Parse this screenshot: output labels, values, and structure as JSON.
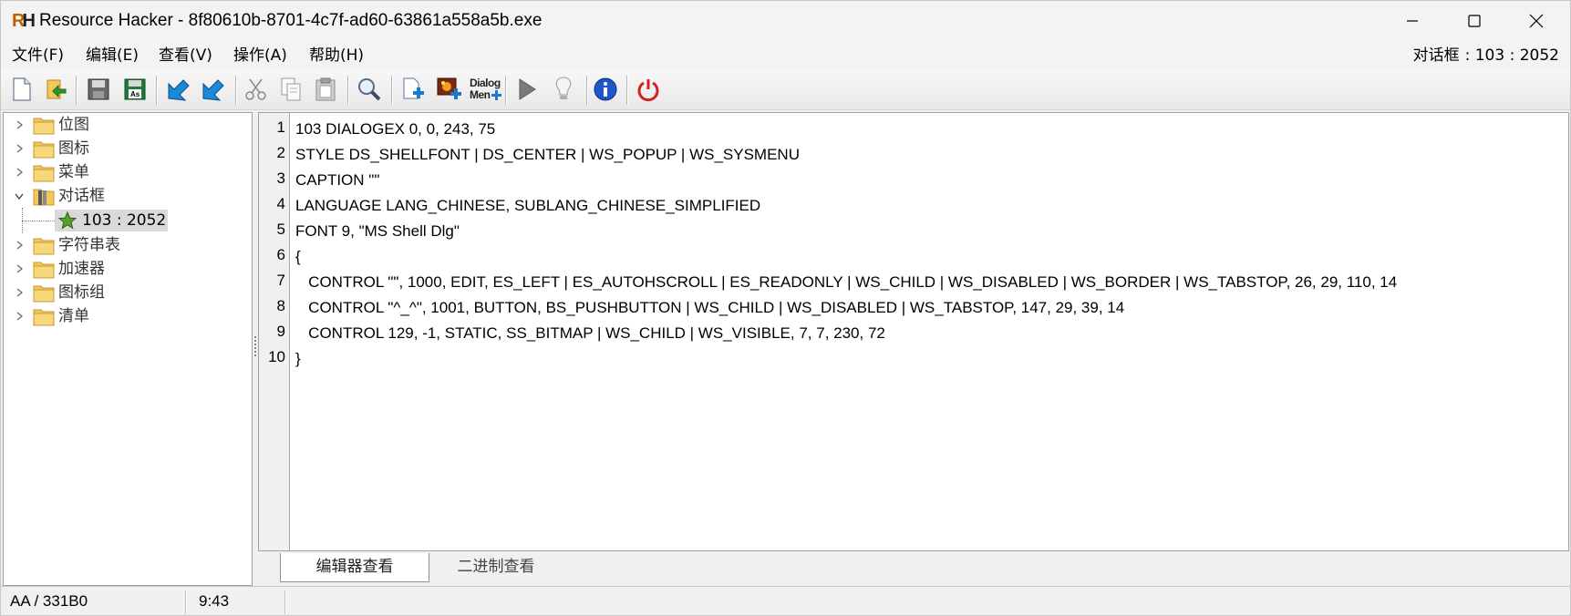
{
  "window": {
    "icon_text_a": "R",
    "icon_text_b": "H",
    "title": "Resource Hacker - 8f80610b-8701-4c7f-ad60-63861a558a5b.exe"
  },
  "menu": {
    "items": [
      "文件(F)",
      "编辑(E)",
      "查看(V)",
      "操作(A)",
      "帮助(H)"
    ],
    "context_type": "对话框",
    "context_id": ": 103 : 2052"
  },
  "toolbar": {
    "buttons": [
      "new-file",
      "open-file",
      "save",
      "save-as",
      "compile",
      "bookmark",
      "cut",
      "copy",
      "paste",
      "find",
      "add-resource",
      "add-image",
      "dialog-menu",
      "run",
      "hint",
      "about",
      "exit"
    ],
    "dialog_label_1": "Dialog",
    "dialog_label_2": "Men"
  },
  "tree": {
    "nodes": [
      {
        "label": "位图",
        "expanded": false
      },
      {
        "label": "图标",
        "expanded": false
      },
      {
        "label": "菜单",
        "expanded": false
      },
      {
        "label": "对话框",
        "expanded": true
      },
      {
        "label": "字符串表",
        "expanded": false
      },
      {
        "label": "加速器",
        "expanded": false
      },
      {
        "label": "图标组",
        "expanded": false
      },
      {
        "label": "清单",
        "expanded": false
      }
    ],
    "selected_child": "103 : 2052"
  },
  "editor": {
    "line_numbers": [
      "1",
      "2",
      "3",
      "4",
      "5",
      "6",
      "7",
      "8",
      "9",
      "10"
    ],
    "lines": [
      "103 DIALOGEX 0, 0, 243, 75",
      "STYLE DS_SHELLFONT | DS_CENTER | WS_POPUP | WS_SYSMENU",
      "CAPTION \"\"",
      "LANGUAGE LANG_CHINESE, SUBLANG_CHINESE_SIMPLIFIED",
      "FONT 9, \"MS Shell Dlg\"",
      "{",
      "   CONTROL \"\", 1000, EDIT, ES_LEFT | ES_AUTOHSCROLL | ES_READONLY | WS_CHILD | WS_DISABLED | WS_BORDER | WS_TABSTOP, 26, 29, 110, 14",
      "   CONTROL \"^_^\", 1001, BUTTON, BS_PUSHBUTTON | WS_CHILD | WS_DISABLED | WS_TABSTOP, 147, 29, 39, 14",
      "   CONTROL 129, -1, STATIC, SS_BITMAP | WS_CHILD | WS_VISIBLE, 7, 7, 230, 72",
      "}"
    ]
  },
  "tabs": {
    "editor_view": "编辑器查看",
    "binary_view": "二进制查看",
    "active": "editor_view"
  },
  "status": {
    "address": "AA / 331B0",
    "position": "9:43"
  },
  "colors": {
    "title_bg": "#f3f3f3",
    "selection_bg": "#d9d9d9",
    "folder_yellow": "#f2c85b",
    "exit_red": "#d22020",
    "info_blue": "#1c56c8"
  }
}
